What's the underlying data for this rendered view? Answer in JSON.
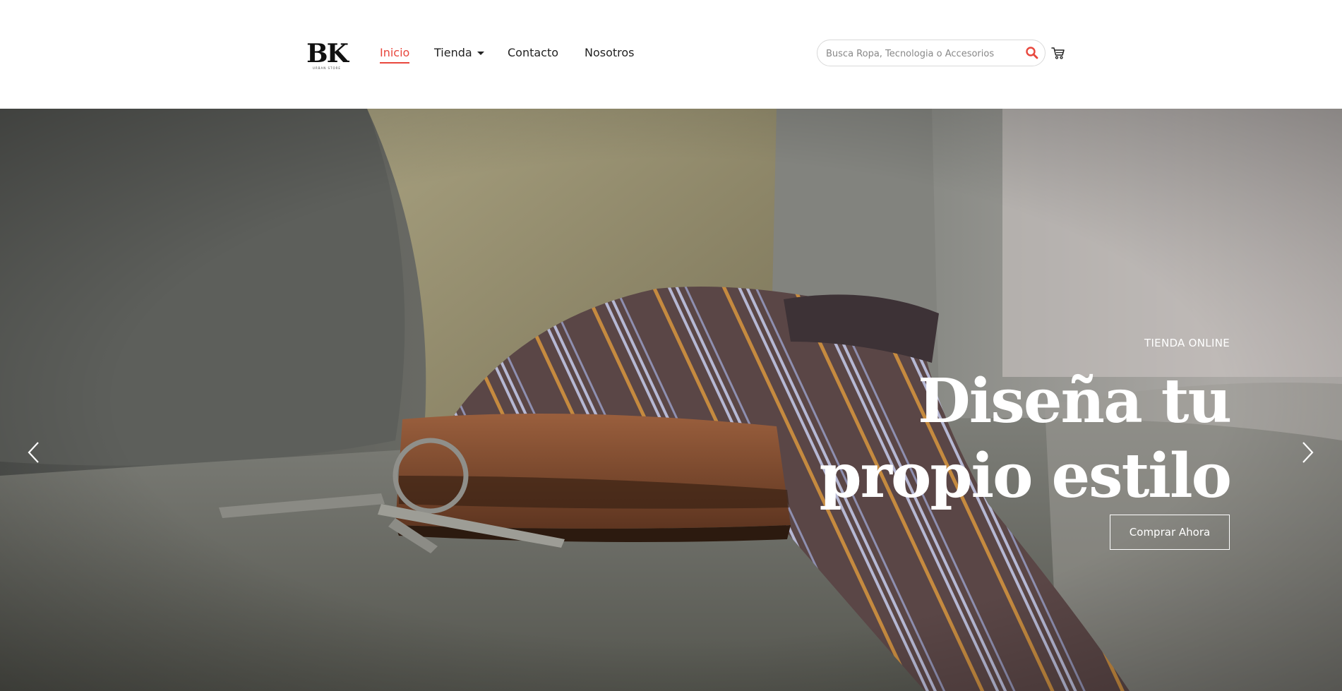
{
  "brand": {
    "logo_text": "BK",
    "logo_subtext": "URBAN STORE"
  },
  "nav": {
    "items": [
      {
        "label": "Inicio",
        "active": true
      },
      {
        "label": "Tienda",
        "has_dropdown": true
      },
      {
        "label": "Contacto"
      },
      {
        "label": "Nosotros"
      }
    ]
  },
  "search": {
    "placeholder": "Busca Ropa, Tecnologia o Accesorios",
    "value": "",
    "icon": "search-icon"
  },
  "cart": {
    "icon": "cart-icon"
  },
  "hero": {
    "eyebrow": "TIENDA ONLINE",
    "title_line1": "Diseña tu",
    "title_line2": "propio estilo",
    "cta_label": "Comprar Ahora",
    "prev_icon": "chevron-left-icon",
    "next_icon": "chevron-right-icon"
  },
  "colors": {
    "accent": "#e8473d",
    "text": "#222222",
    "hero_text": "#ffffff"
  }
}
